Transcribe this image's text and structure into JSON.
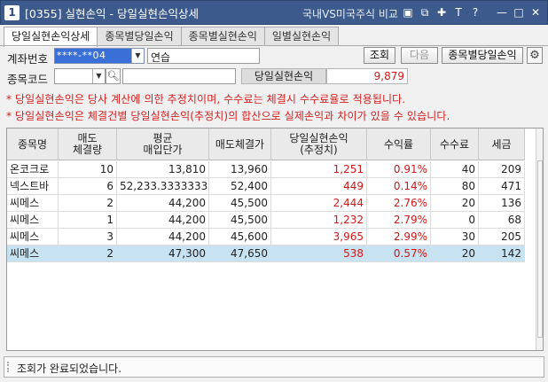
{
  "window": {
    "number": "1",
    "title": "[0355] 실현손익 - 당일실현손익상세",
    "link": "국내VS미국주식 비교",
    "icons": [
      "window-icon",
      "layout-icon",
      "pin-icon",
      "font-icon",
      "help-icon",
      "minimize-icon",
      "maximize-icon",
      "close-icon"
    ],
    "icon_glyphs": [
      "▣",
      "⧉",
      "✚",
      "T",
      "?",
      "—",
      "□",
      "✕"
    ]
  },
  "tabs": [
    {
      "label": "당일실현손익상세",
      "active": true
    },
    {
      "label": "종목별당일손익",
      "active": false
    },
    {
      "label": "종목별실현손익",
      "active": false
    },
    {
      "label": "일별실현손익",
      "active": false
    }
  ],
  "form": {
    "account_label": "계좌번호",
    "account_value": "****-**04",
    "account_name": "연습",
    "query_button": "조회",
    "next_button": "다음",
    "by_stock_button": "종목별당일손익",
    "code_label": "종목코드",
    "code_value": "",
    "code_name": "",
    "sum_label": "당일실현손익",
    "sum_value": "9,879"
  },
  "notices": [
    "* 당일실현손익은 당사 계산에 의한 추정치이며, 수수료는 체결시 수수료율로 적용됩니다.",
    "* 당일실현손익은 체결건별 당일실현손익(추정치)의 합산으로 실제손익과 차이가 있을 수 있습니다."
  ],
  "table": {
    "columns": [
      "종목명",
      "매도\n체결량",
      "평균\n매입단가",
      "매도체결가",
      "당일실현손익\n(추정치)",
      "수익률",
      "수수료",
      "세금"
    ],
    "rows": [
      [
        "온코크로",
        "10",
        "13,810",
        "13,960",
        "1,251",
        "0.91%",
        "40",
        "209"
      ],
      [
        "넥스트바",
        "6",
        "52,233.3333333",
        "52,400",
        "449",
        "0.14%",
        "80",
        "471"
      ],
      [
        "씨메스",
        "2",
        "44,200",
        "45,500",
        "2,444",
        "2.76%",
        "20",
        "136"
      ],
      [
        "씨메스",
        "1",
        "44,200",
        "45,500",
        "1,232",
        "2.79%",
        "0",
        "68"
      ],
      [
        "씨메스",
        "3",
        "44,200",
        "45,600",
        "3,965",
        "2.99%",
        "30",
        "205"
      ],
      [
        "씨메스",
        "2",
        "47,300",
        "47,650",
        "538",
        "0.57%",
        "20",
        "142"
      ]
    ],
    "selected_row": 5
  },
  "status": "조회가 완료되었습니다."
}
